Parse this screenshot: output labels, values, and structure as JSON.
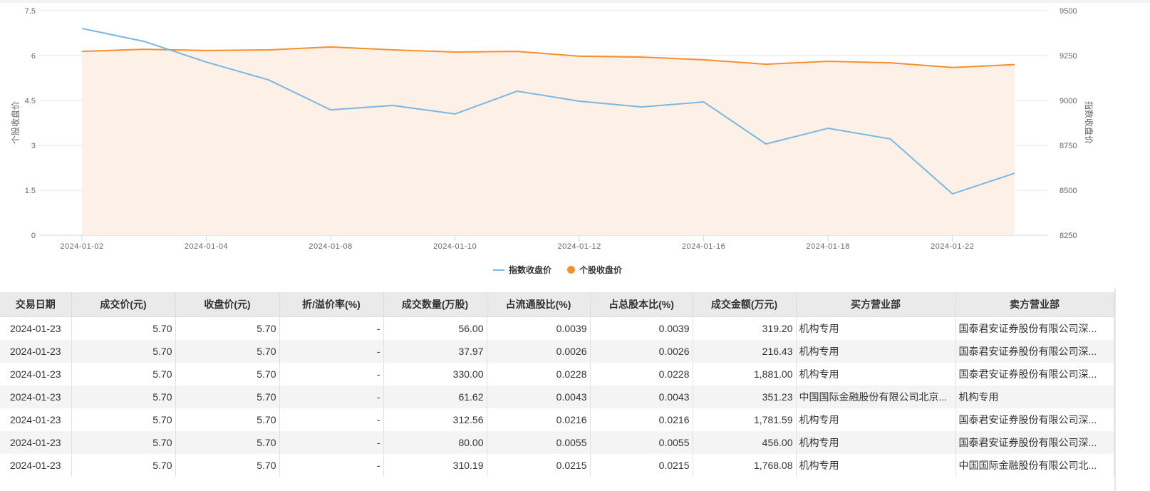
{
  "chart_data": {
    "type": "line",
    "x": [
      "2024-01-02",
      "2024-01-03",
      "2024-01-04",
      "2024-01-05",
      "2024-01-08",
      "2024-01-09",
      "2024-01-10",
      "2024-01-11",
      "2024-01-12",
      "2024-01-15",
      "2024-01-16",
      "2024-01-17",
      "2024-01-18",
      "2024-01-19",
      "2024-01-22",
      "2024-01-23"
    ],
    "x_tick_labels": [
      "2024-01-02",
      "2024-01-04",
      "2024-01-08",
      "2024-01-10",
      "2024-01-12",
      "2024-01-16",
      "2024-01-18",
      "2024-01-22"
    ],
    "series": [
      {
        "name": "指数收盘价",
        "axis": "right",
        "type": "line",
        "color": "#7ab8e4",
        "values": [
          9401,
          9329,
          9214,
          9115,
          8948,
          8972,
          8925,
          9052,
          8996,
          8964,
          8992,
          8758,
          8845,
          8786,
          8480,
          8595
        ]
      },
      {
        "name": "个股收盘价",
        "axis": "left",
        "type": "area",
        "color": "#f5902e",
        "values": [
          6.14,
          6.21,
          6.17,
          6.19,
          6.29,
          6.19,
          6.12,
          6.14,
          5.98,
          5.95,
          5.86,
          5.71,
          5.81,
          5.76,
          5.6,
          5.7
        ]
      }
    ],
    "ylabel": "个股收盘价",
    "y2label": "指数收盘价",
    "ylim": [
      0,
      7.5
    ],
    "y_ticks": [
      "0",
      "1.5",
      "3",
      "4.5",
      "6",
      "7.5"
    ],
    "y2lim": [
      8250,
      9500
    ],
    "y2_ticks": [
      "8250",
      "8500",
      "8750",
      "9000",
      "9250",
      "9500"
    ],
    "grid": true,
    "legend": "bottom-center"
  },
  "table": {
    "headers": [
      "交易日期",
      "成交价(元)",
      "收盘价(元)",
      "折/溢价率(%)",
      "成交数量(万股)",
      "占流通股比(%)",
      "占总股本比(%)",
      "成交金额(万元)",
      "买方营业部",
      "卖方营业部"
    ],
    "rows": [
      [
        "2024-01-23",
        "5.70",
        "5.70",
        "-",
        "56.00",
        "0.0039",
        "0.0039",
        "319.20",
        "机构专用",
        "国泰君安证券股份有限公司深..."
      ],
      [
        "2024-01-23",
        "5.70",
        "5.70",
        "-",
        "37.97",
        "0.0026",
        "0.0026",
        "216.43",
        "机构专用",
        "国泰君安证券股份有限公司深..."
      ],
      [
        "2024-01-23",
        "5.70",
        "5.70",
        "-",
        "330.00",
        "0.0228",
        "0.0228",
        "1,881.00",
        "机构专用",
        "国泰君安证券股份有限公司深..."
      ],
      [
        "2024-01-23",
        "5.70",
        "5.70",
        "-",
        "61.62",
        "0.0043",
        "0.0043",
        "351.23",
        "中国国际金融股份有限公司北京...",
        "机构专用"
      ],
      [
        "2024-01-23",
        "5.70",
        "5.70",
        "-",
        "312.56",
        "0.0216",
        "0.0216",
        "1,781.59",
        "机构专用",
        "国泰君安证券股份有限公司深..."
      ],
      [
        "2024-01-23",
        "5.70",
        "5.70",
        "-",
        "80.00",
        "0.0055",
        "0.0055",
        "456.00",
        "机构专用",
        "国泰君安证券股份有限公司深..."
      ],
      [
        "2024-01-23",
        "5.70",
        "5.70",
        "-",
        "310.19",
        "0.0215",
        "0.0215",
        "1,768.08",
        "机构专用",
        "中国国际金融股份有限公司北..."
      ]
    ]
  }
}
